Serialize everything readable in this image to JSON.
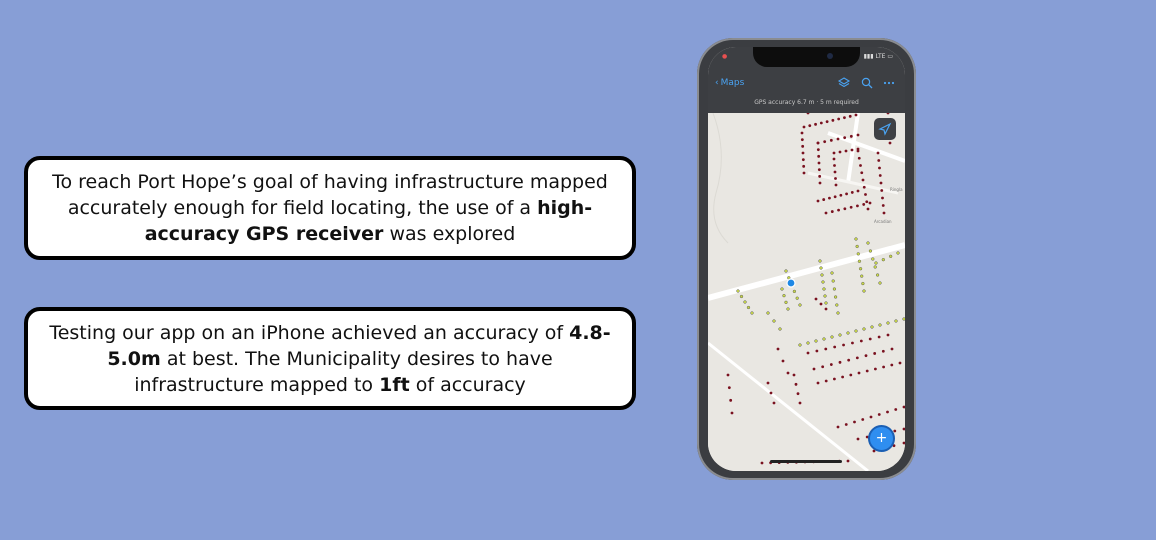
{
  "callouts": [
    {
      "part1": "To reach Port Hope’s goal of having infrastructure mapped accurately enough for field locating, the use of a ",
      "bold1": "high-accuracy GPS receiver",
      "part2": " was explored"
    },
    {
      "part1": "Testing our app on an iPhone achieved an accuracy of ",
      "bold1": "4.8-5.0m",
      "part2": " at best. The Municipality desires to have infrastructure mapped to ",
      "bold2": "1ft",
      "part3": " of accuracy"
    }
  ],
  "phone": {
    "status_right": "LTE",
    "nav": {
      "back_label": "Maps",
      "layers_icon": "layers-icon",
      "search_icon": "search-icon",
      "more_icon": "more-icon"
    },
    "gps_text": "GPS accuracy 6.7 m  ·  5 m required",
    "map": {
      "street_label_1": "Ringla",
      "street_label_2": "Arcadian",
      "colors": {
        "dark_points": "#7a1220",
        "yellow_points": "#c9d84a",
        "location_dot": "#1e88e5",
        "road": "#ffffff",
        "background": "#e9e7e2"
      }
    },
    "fab_icon": "plus-icon",
    "compass_icon": "navigate-icon"
  }
}
